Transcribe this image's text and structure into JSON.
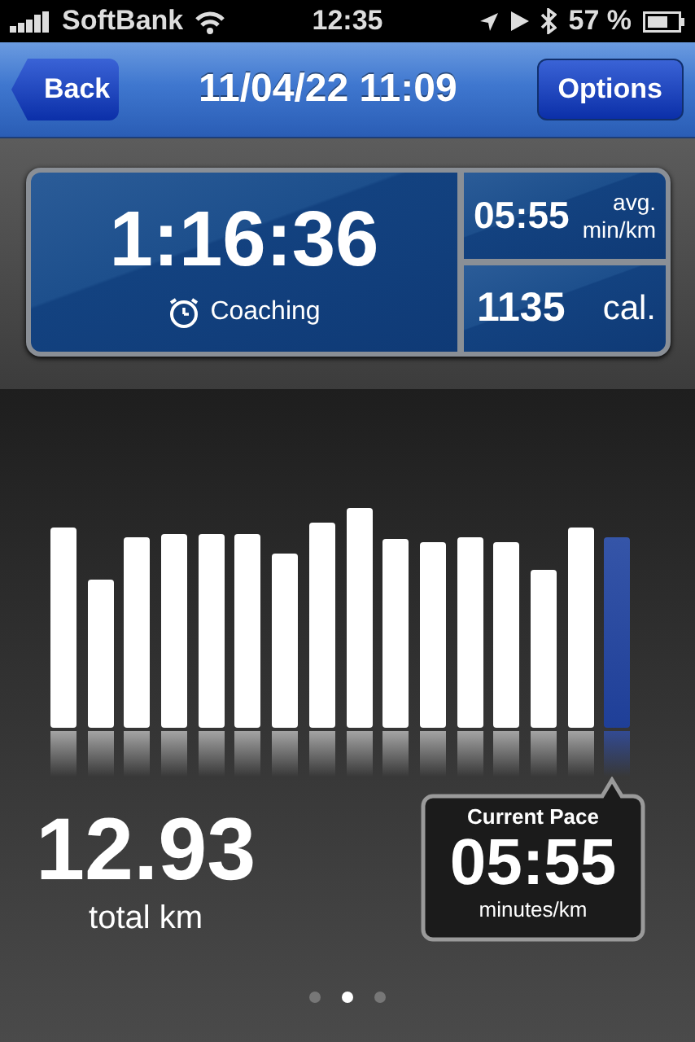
{
  "status_bar": {
    "carrier": "SoftBank",
    "time": "12:35",
    "battery": "57 %"
  },
  "nav_bar": {
    "back": "Back",
    "title": "11/04/22 11:09",
    "options": "Options"
  },
  "summary": {
    "duration": "1:16:36",
    "coaching": "Coaching",
    "pace": "05:55",
    "pace_unit_top": "avg.",
    "pace_unit_bottom": "min/km",
    "calories": "1135",
    "calories_unit": "cal."
  },
  "pace_bars": [
    {
      "selected": false
    },
    {
      "selected": false
    },
    {
      "selected": false
    },
    {
      "selected": false
    },
    {
      "selected": false
    },
    {
      "selected": false
    },
    {
      "selected": false
    },
    {
      "selected": false
    },
    {
      "selected": false
    },
    {
      "selected": false
    },
    {
      "selected": false
    },
    {
      "selected": false
    },
    {
      "selected": false
    },
    {
      "selected": false
    },
    {
      "selected": false
    },
    {
      "selected": true
    }
  ],
  "distance": {
    "value": "12.93",
    "unit": "total km"
  },
  "current_pace": {
    "title": "Current Pace",
    "value": "05:55",
    "unit": "minutes/km"
  },
  "page_dots": [
    {
      "selected": false
    },
    {
      "selected": true
    },
    {
      "selected": false
    }
  ]
}
